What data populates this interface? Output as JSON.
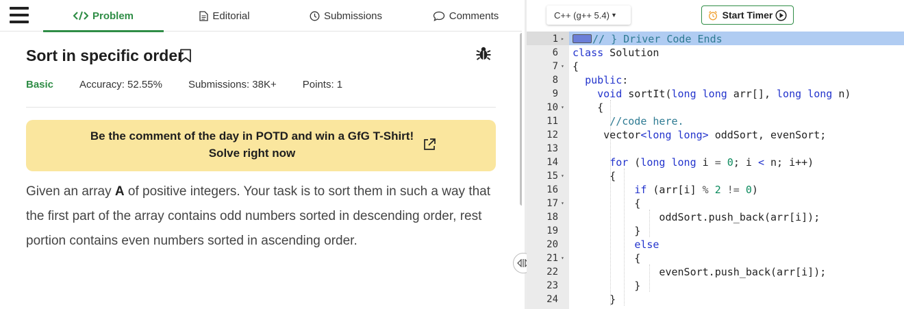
{
  "tabs": [
    {
      "label": "Problem",
      "icon": "code-icon"
    },
    {
      "label": "Editorial",
      "icon": "document-icon"
    },
    {
      "label": "Submissions",
      "icon": "clock-icon"
    },
    {
      "label": "Comments",
      "icon": "comment-icon"
    }
  ],
  "problem": {
    "title": "Sort in specific order",
    "difficulty": "Basic",
    "accuracy": "Accuracy: 52.55%",
    "submissions": "Submissions: 38K+",
    "points": "Points: 1",
    "banner_line1": "Be the comment of the day in POTD and win a GfG T-Shirt!",
    "banner_line2": "Solve right now",
    "desc_part1": "Given an array ",
    "desc_bold": "A",
    "desc_part2": " of positive integers. Your task is to sort them in such a way that the first part of the array contains odd numbers sorted in descending order, rest portion contains even numbers sorted in ascending order."
  },
  "editor": {
    "language": "C++ (g++ 5.4)",
    "timer_label": "Start Timer",
    "lines": [
      {
        "num": "1",
        "fold": "▸",
        "text": "// } Driver Code Ends"
      },
      {
        "num": "6",
        "fold": "",
        "text": "class Solution"
      },
      {
        "num": "7",
        "fold": "▾",
        "text": "{"
      },
      {
        "num": "8",
        "fold": "",
        "text": "  public:"
      },
      {
        "num": "9",
        "fold": "",
        "text": "    void sortIt(long long arr[], long long n)"
      },
      {
        "num": "10",
        "fold": "▾",
        "text": "    {"
      },
      {
        "num": "11",
        "fold": "",
        "text": "      //code here."
      },
      {
        "num": "12",
        "fold": "",
        "text": "     vector<long long> oddSort, evenSort;"
      },
      {
        "num": "13",
        "fold": "",
        "text": ""
      },
      {
        "num": "14",
        "fold": "",
        "text": "      for (long long i = 0; i < n; i++)"
      },
      {
        "num": "15",
        "fold": "▾",
        "text": "      {"
      },
      {
        "num": "16",
        "fold": "",
        "text": "          if (arr[i] % 2 != 0)"
      },
      {
        "num": "17",
        "fold": "▾",
        "text": "          {"
      },
      {
        "num": "18",
        "fold": "",
        "text": "              oddSort.push_back(arr[i]);"
      },
      {
        "num": "19",
        "fold": "",
        "text": "          }"
      },
      {
        "num": "20",
        "fold": "",
        "text": "          else"
      },
      {
        "num": "21",
        "fold": "▾",
        "text": "          {"
      },
      {
        "num": "22",
        "fold": "",
        "text": "              evenSort.push_back(arr[i]);"
      },
      {
        "num": "23",
        "fold": "",
        "text": "          }"
      },
      {
        "num": "24",
        "fold": "",
        "text": "      }"
      }
    ]
  },
  "colors": {
    "accent": "#2f8d46",
    "banner": "#fae69e",
    "line_highlight": "#b0ccf2",
    "keyword": "#2233cc",
    "comment": "#2d7a92",
    "number": "#0b8a5d"
  }
}
